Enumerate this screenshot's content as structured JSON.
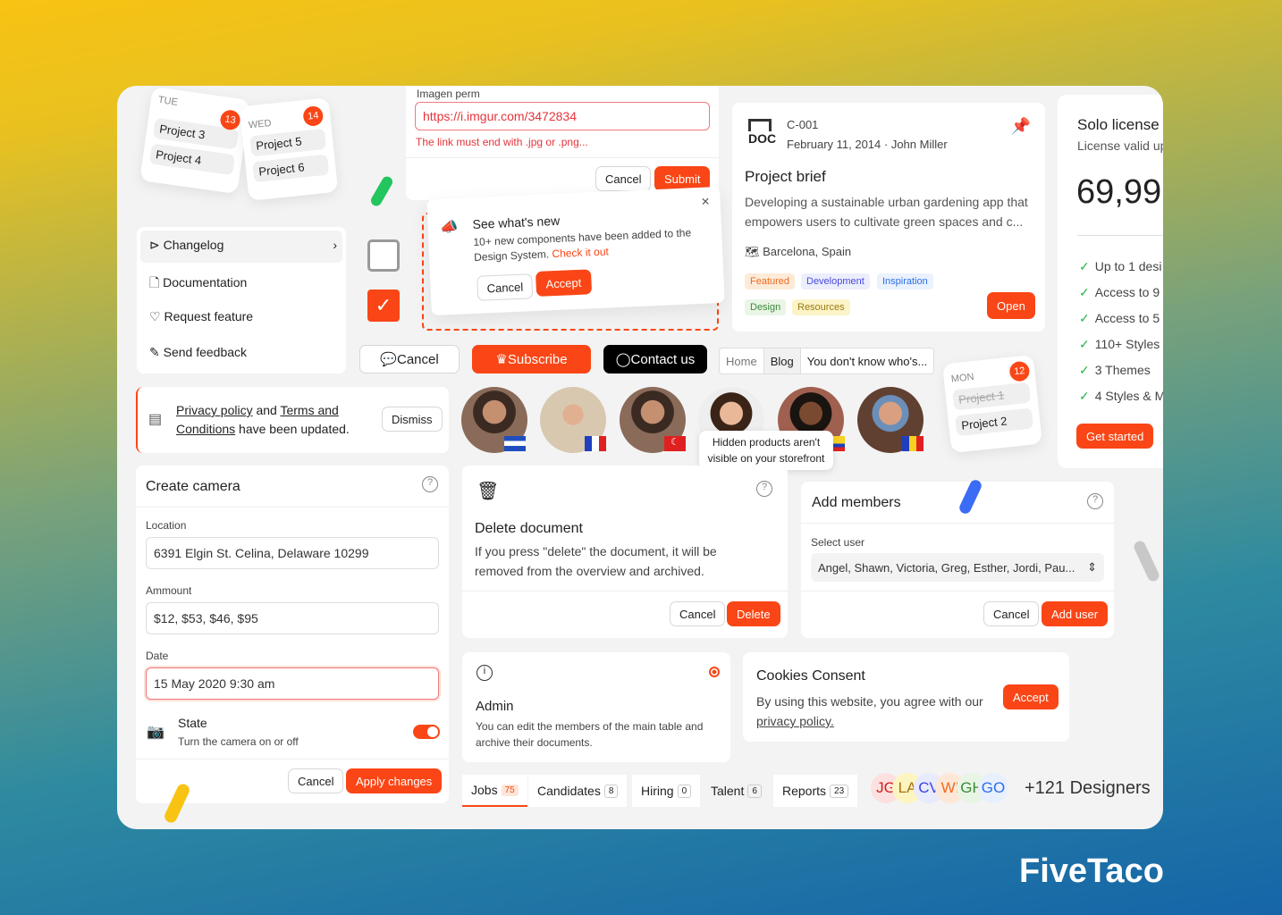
{
  "calendar": {
    "tue": {
      "day": "TUE",
      "num": "13",
      "items": [
        "Project 3",
        "Project 4"
      ]
    },
    "wed": {
      "day": "WED",
      "num": "14",
      "items": [
        "Project 5",
        "Project 6"
      ]
    },
    "mon": {
      "day": "MON",
      "num": "12",
      "items": [
        "Project 1",
        "Project 2"
      ]
    }
  },
  "image_form": {
    "label": "Imagen perm",
    "value": "https://i.imgur.com/3472834",
    "error": "The link must end with .jpg or .png...",
    "cancel": "Cancel",
    "submit": "Submit"
  },
  "whats_new": {
    "title": "See what's new",
    "body": "10+ new components have been added to the Design System.",
    "link": "Check it out",
    "cancel": "Cancel",
    "accept": "Accept"
  },
  "menu": {
    "items": [
      {
        "label": "Changelog",
        "icon": "megaphone-icon"
      },
      {
        "label": "Documentation",
        "icon": "file-icon"
      },
      {
        "label": "Request feature",
        "icon": "heart-icon"
      },
      {
        "label": "Send feedback",
        "icon": "pencil-icon"
      }
    ]
  },
  "buttons": {
    "cancel": "Cancel",
    "subscribe": "Subscribe",
    "contact": "Contact us"
  },
  "breadcrumb": [
    "Home",
    "Blog",
    "You don't know who's..."
  ],
  "privacy": {
    "p1": "Privacy policy",
    "and": " and ",
    "p2": "Terms and Conditions",
    "rest": " have been updated.",
    "dismiss": "Dismiss"
  },
  "tooltip": "Hidden products aren't visible on your storefront",
  "doc": {
    "code": "C-001",
    "meta": "February 11, 2014 · John Miller",
    "icon_label": "DOC",
    "title": "Project brief",
    "desc": "Developing a sustainable urban gardening app that empowers users to cultivate green spaces and c...",
    "location": "Barcelona, Spain",
    "tags": [
      "Featured",
      "Development",
      "Inspiration",
      "Design",
      "Resources"
    ],
    "open": "Open"
  },
  "license": {
    "title": "Solo license",
    "sub": "License valid up",
    "price": "69,99",
    "features": [
      "Up to 1 desi",
      "Access to 9",
      "Access to 5",
      "110+ Styles",
      "3 Themes",
      "4 Styles & M"
    ],
    "cta": "Get started"
  },
  "camera": {
    "title": "Create camera",
    "location_label": "Location",
    "location": "6391 Elgin St. Celina, Delaware 10299",
    "amount_label": "Ammount",
    "amount": "$12, $53, $46, $95",
    "date_label": "Date",
    "date": "15 May 2020 9:30 am",
    "state_title": "State",
    "state_desc": "Turn the camera on or off",
    "state_on": true,
    "cancel": "Cancel",
    "apply": "Apply changes"
  },
  "delete_doc": {
    "title": "Delete document",
    "desc": "If you press \"delete\" the document, it will be removed from the overview and archived.",
    "cancel": "Cancel",
    "delete": "Delete"
  },
  "members": {
    "title": "Add members",
    "label": "Select user",
    "value": "Angel, Shawn, Victoria, Greg, Esther, Jordi, Pau...",
    "cancel": "Cancel",
    "add": "Add user"
  },
  "admin": {
    "title": "Admin",
    "desc": "You can edit the members of the main table and archive their documents."
  },
  "cookies": {
    "title": "Cookies Consent",
    "desc": "By using this website, you agree with our",
    "link": "privacy policy.",
    "accept": "Accept"
  },
  "tabs": [
    {
      "label": "Jobs",
      "count": "75"
    },
    {
      "label": "Candidates",
      "count": "8"
    },
    {
      "label": "Hiring",
      "count": "0"
    },
    {
      "label": "Talent",
      "count": "6"
    },
    {
      "label": "Reports",
      "count": "23"
    }
  ],
  "designers": {
    "initials": [
      "JG",
      "LA",
      "CV",
      "WI",
      "GH",
      "GO"
    ],
    "more": "+121 Designers"
  },
  "brand": "FiveTaco",
  "colors": {
    "accent": "#fa4616"
  }
}
